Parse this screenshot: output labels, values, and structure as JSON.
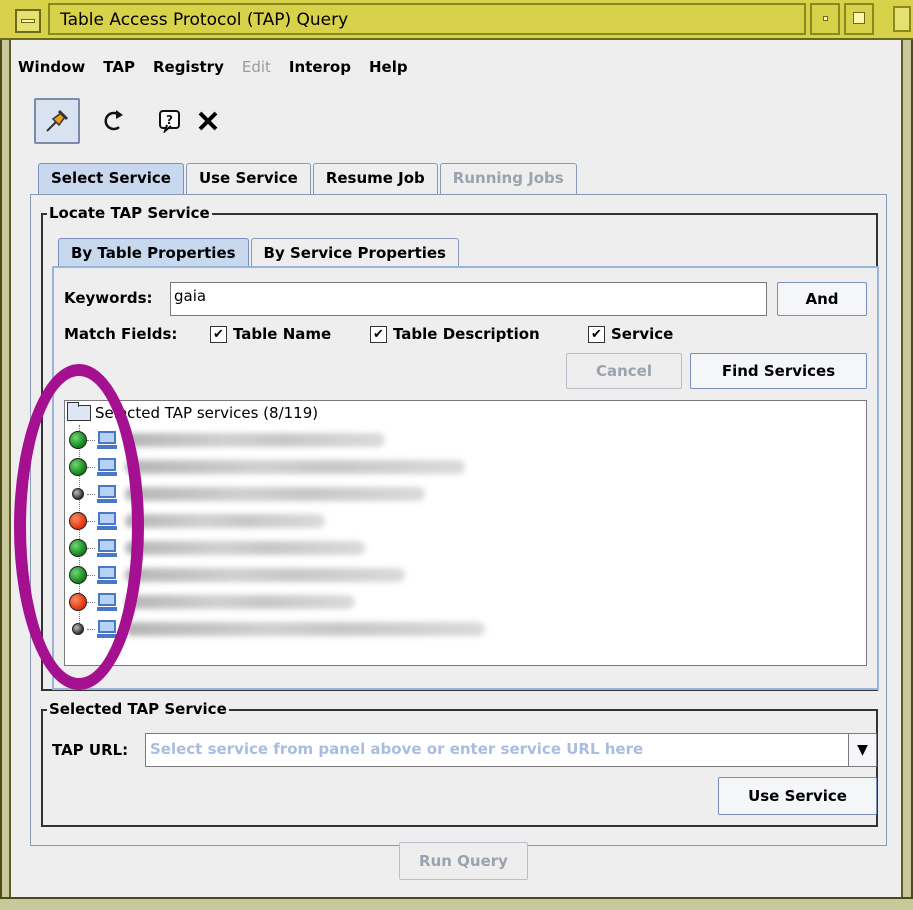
{
  "window": {
    "title": "Table Access Protocol (TAP) Query"
  },
  "menu": {
    "items": [
      {
        "label": "Window",
        "mnemonic": "W",
        "rest": "indow",
        "disabled": false
      },
      {
        "label": "TAP",
        "mnemonic": "T",
        "rest": "AP",
        "disabled": false
      },
      {
        "label": "Registry",
        "mnemonic": "",
        "rest": "Registry",
        "disabled": false
      },
      {
        "label": "Edit",
        "mnemonic": "E",
        "rest": "dit",
        "disabled": true
      },
      {
        "label": "Interop",
        "mnemonic": "I",
        "rest": "nterop",
        "disabled": false
      },
      {
        "label": "Help",
        "mnemonic": "H",
        "rest": "elp",
        "disabled": false
      }
    ]
  },
  "toolbar": {
    "icons": [
      "pin-icon",
      "reload-icon",
      "help-icon",
      "close-icon"
    ],
    "pin_glyph": "📌",
    "reload_glyph": "↻",
    "help_glyph": "?",
    "close_glyph": "✕"
  },
  "tabs": {
    "outer": [
      "Select Service",
      "Use Service",
      "Resume Job",
      "Running Jobs"
    ],
    "inner": [
      "By Table Properties",
      "By Service Properties"
    ]
  },
  "locate": {
    "title": "Locate TAP Service",
    "keywords_label": "Keywords:",
    "keywords_value": "gaia",
    "and_button": "And",
    "match_fields_label": "Match Fields:",
    "check_table_name": "Table Name",
    "check_table_desc": "Table Description",
    "check_service": "Service",
    "check_mark": "✔",
    "cancel_button": "Cancel",
    "find_button": "Find Services"
  },
  "tree": {
    "root_label": "Selected TAP services (8/119)",
    "rows": [
      {
        "status": "green"
      },
      {
        "status": "green"
      },
      {
        "status": "grey"
      },
      {
        "status": "red"
      },
      {
        "status": "green"
      },
      {
        "status": "green"
      },
      {
        "status": "red"
      },
      {
        "status": "grey"
      }
    ]
  },
  "selected": {
    "title": "Selected TAP Service",
    "url_label": "TAP URL:",
    "url_placeholder": "Select service from panel above or enter service URL here",
    "dropdown_arrow": "▼",
    "use_button": "Use Service"
  },
  "footer": {
    "run_query": "Run Query"
  },
  "colors": {
    "titlebar": "#d8d24a",
    "annotation": "#a4108f",
    "placeholder": "#a9bde0"
  }
}
